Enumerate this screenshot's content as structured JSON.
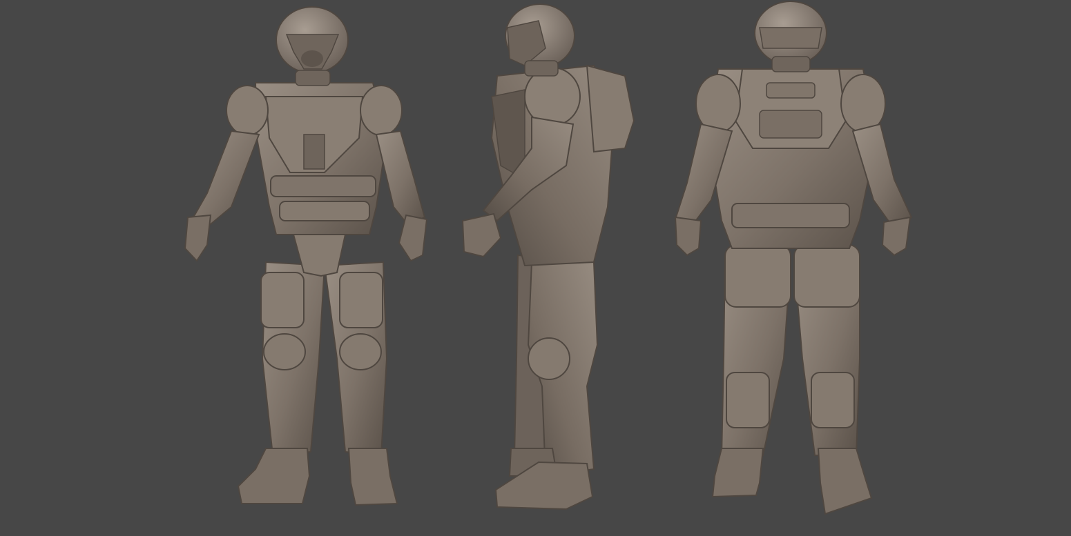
{
  "scene": {
    "background_color": "#474747",
    "clay_color": "#7d7268",
    "clay_shadow": "#4f4740",
    "clay_highlight": "#a0958a",
    "views": [
      {
        "id": "front",
        "icon": "figure-front"
      },
      {
        "id": "side",
        "icon": "figure-side"
      },
      {
        "id": "back",
        "icon": "figure-back"
      }
    ]
  }
}
